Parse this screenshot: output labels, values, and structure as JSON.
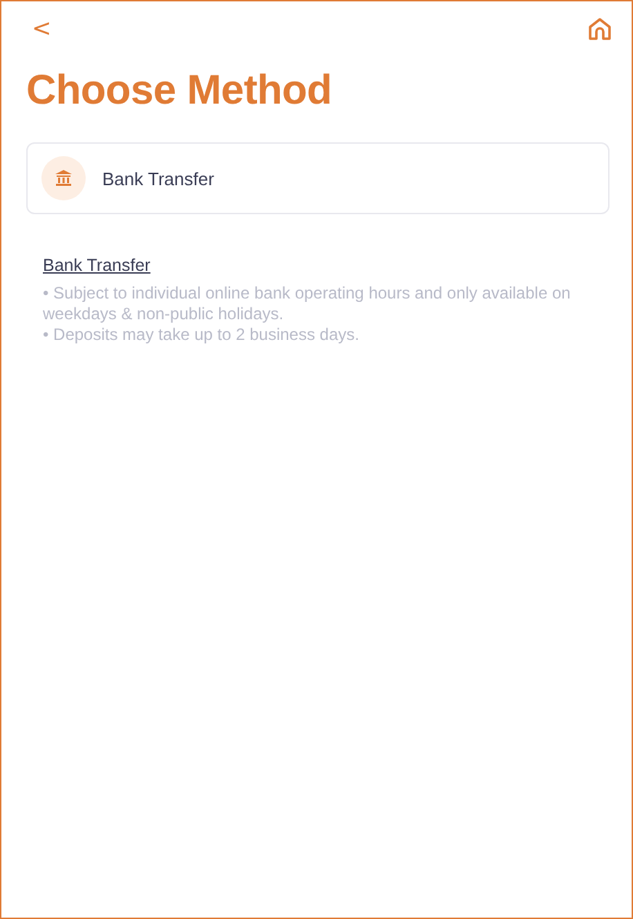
{
  "header": {
    "back": "<"
  },
  "title": "Choose Method",
  "methods": [
    {
      "label": "Bank Transfer"
    }
  ],
  "info": {
    "heading": "Bank Transfer",
    "notes": [
      "• Subject to individual online bank operating hours and only available on weekdays & non-public holidays.",
      "• Deposits may take up to 2 business days."
    ]
  }
}
